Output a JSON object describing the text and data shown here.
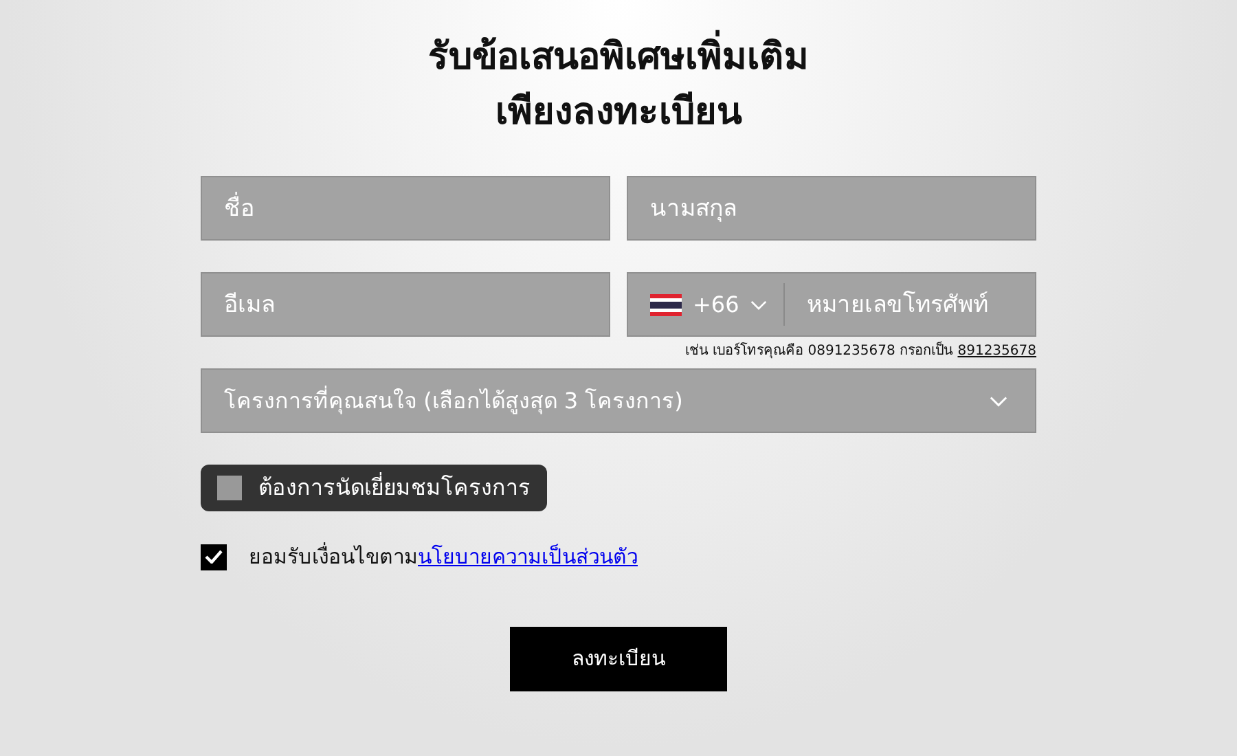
{
  "title": [
    "รับข้อเสนอพิเศษเพิ่มเติม",
    "เพียงลงทะเบียน"
  ],
  "fields": {
    "first_name": {
      "placeholder": "ชื่อ"
    },
    "last_name": {
      "placeholder": "นามสกุล"
    },
    "email": {
      "placeholder": "อีเมล"
    },
    "phone": {
      "country_code": "+66",
      "placeholder": "หมายเลขโทรศัพท์"
    }
  },
  "phone_hint": {
    "text": "เช่น เบอร์โทรคุณคือ 0891235678 กรอกเป็น",
    "example": "891235678"
  },
  "projects_select": {
    "placeholder": "โครงการที่คุณสนใจ (เลือกได้สูงสุด 3 โครงการ)"
  },
  "visit_toggle": {
    "label": "ต้องการนัดเยี่ยมชมโครงการ",
    "checked": false
  },
  "consent": {
    "checked": true,
    "text": "ยอมรับเงื่อนไขตาม",
    "link": "นโยบายความเป็นส่วนตัว"
  },
  "submit": "ลงทะเบียน"
}
